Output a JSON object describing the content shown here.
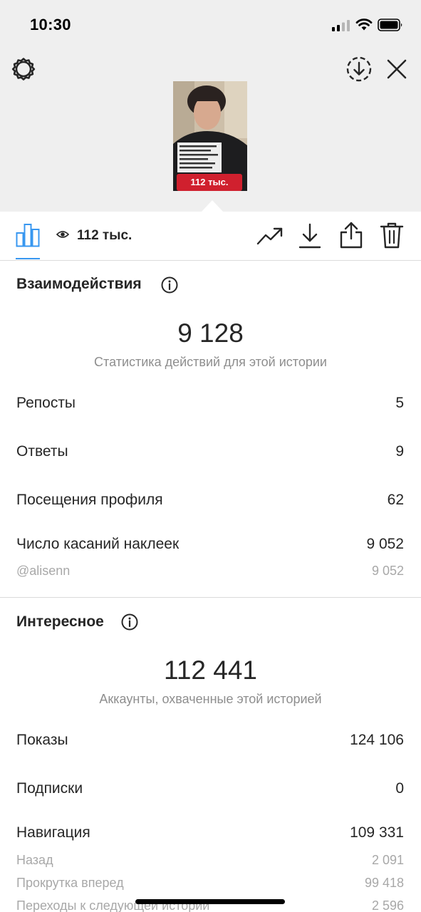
{
  "status_bar": {
    "time": "10:30"
  },
  "story": {
    "badge_text": "112 тыс."
  },
  "toolbar": {
    "views_count": "112 тыс."
  },
  "interactions": {
    "title": "Взаимодействия",
    "total": "9 128",
    "caption": "Статистика действий для этой истории",
    "rows": [
      {
        "label": "Репосты",
        "value": "5"
      },
      {
        "label": "Ответы",
        "value": "9"
      },
      {
        "label": "Посещения профиля",
        "value": "62"
      },
      {
        "label": "Число касаний наклеек",
        "value": "9 052"
      }
    ],
    "sub_rows": [
      {
        "label": "@alisenn",
        "value": "9 052"
      }
    ]
  },
  "discovery": {
    "title": "Интересное",
    "total": "112 441",
    "caption": "Аккаунты, охваченные этой историей",
    "rows": [
      {
        "label": "Показы",
        "value": "124 106"
      },
      {
        "label": "Подписки",
        "value": "0"
      },
      {
        "label": "Навигация",
        "value": "109 331"
      }
    ],
    "sub_rows": [
      {
        "label": "Назад",
        "value": "2 091"
      },
      {
        "label": "Прокрутка вперед",
        "value": "99 418"
      },
      {
        "label": "Переходы к следующей истории",
        "value": "2 596"
      }
    ]
  },
  "colors": {
    "accent": "#3897f0",
    "text": "#262626",
    "muted": "#8e8e8e",
    "badge": "#d0202e"
  }
}
